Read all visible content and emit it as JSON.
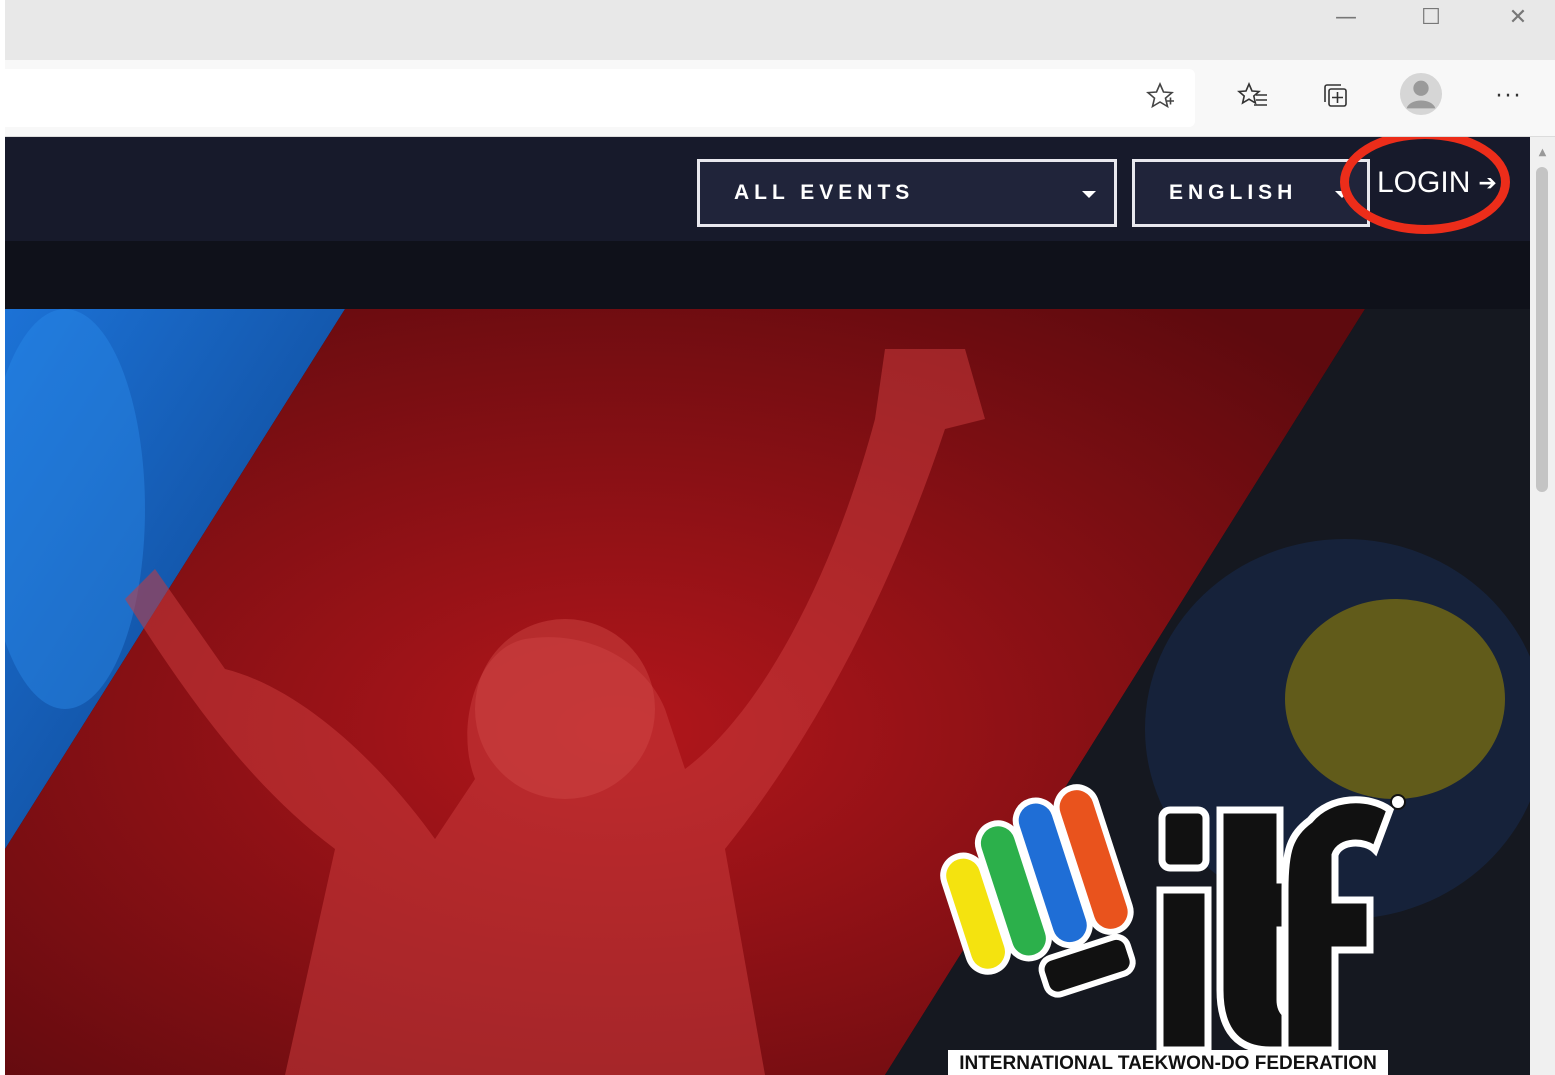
{
  "browser": {
    "window_controls": {
      "minimize": "—",
      "maximize": "☐",
      "close": "✕"
    },
    "toolbar_icons": [
      "star-add-icon",
      "favorites-icon",
      "collections-icon",
      "profile-avatar-icon",
      "more-options-icon"
    ],
    "more_label": "···"
  },
  "site": {
    "events_dropdown": {
      "label": "ALL EVENTS"
    },
    "language_dropdown": {
      "label": "ENGLISH"
    },
    "login": {
      "label": "LOGIN"
    },
    "logo": {
      "caption": "INTERNATIONAL TAEKWON-DO FEDERATION"
    }
  },
  "colors": {
    "header_bg": "#171a2b",
    "hero_red": "#8f1216",
    "hero_blue": "#1e6fd0",
    "annotation_red": "#ec2d1a"
  }
}
